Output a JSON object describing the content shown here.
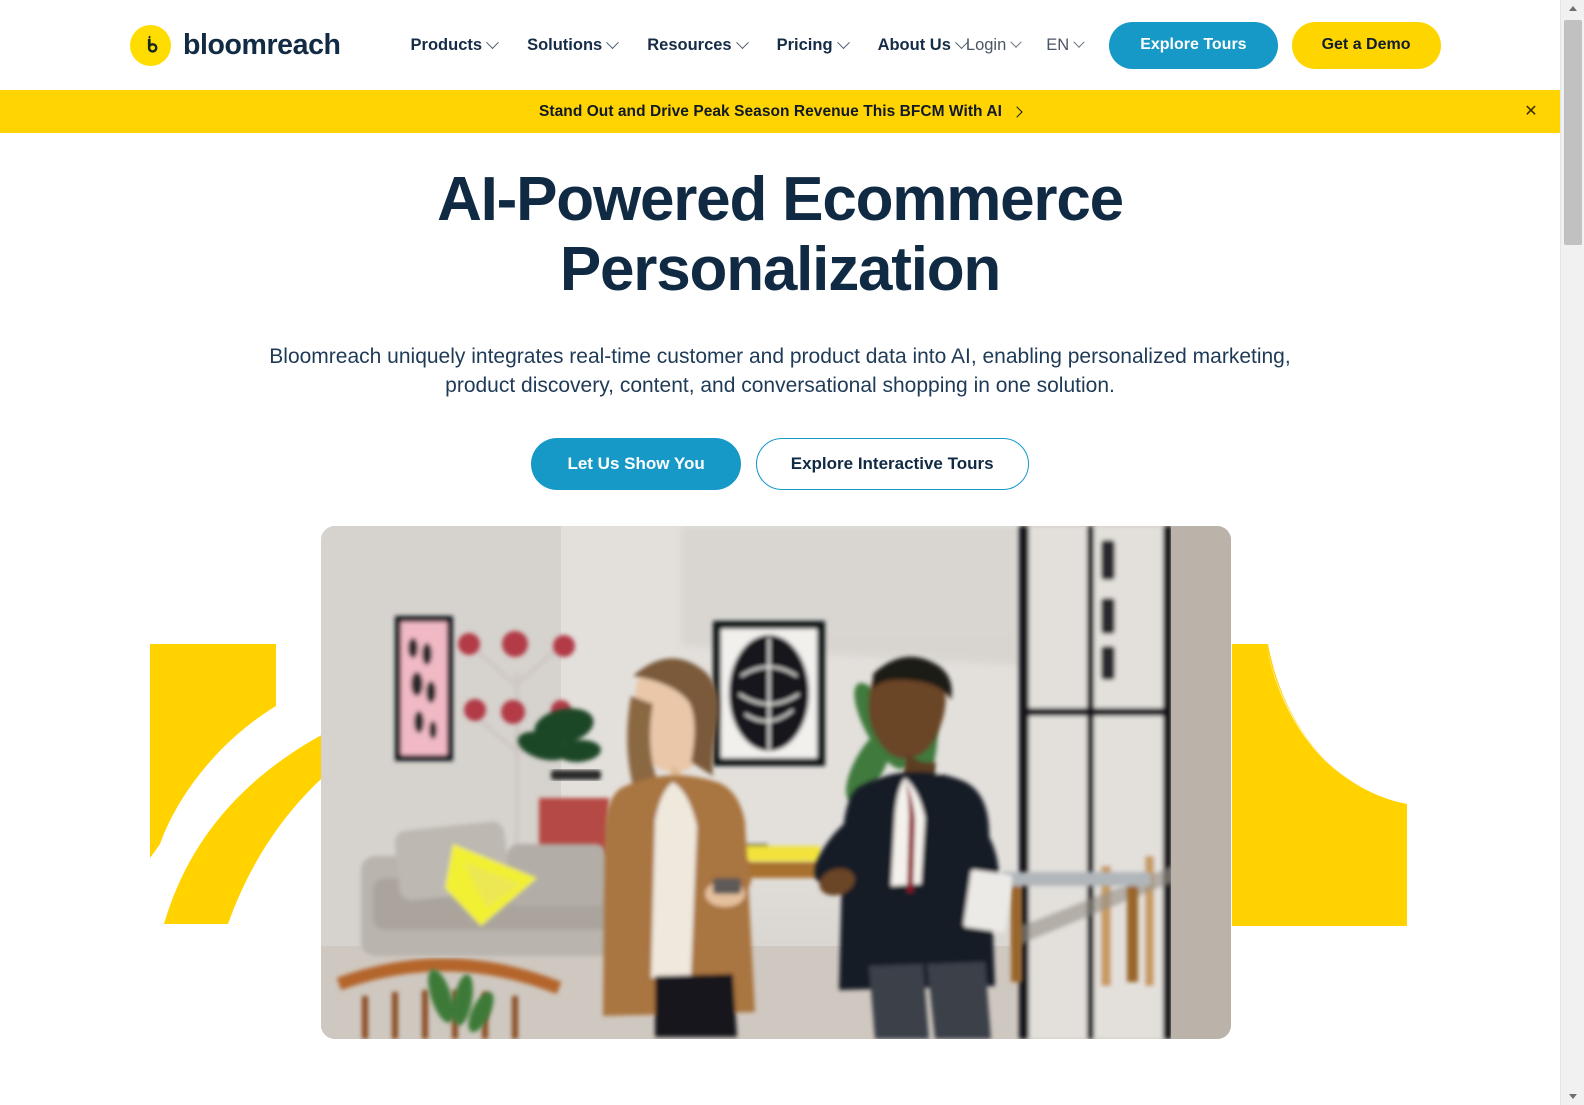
{
  "header": {
    "logo": {
      "mark_icon": "bloomreach-b-icon",
      "wordmark": "bloomreach"
    },
    "nav": [
      {
        "label": "Products",
        "icon": "chevron-down-icon"
      },
      {
        "label": "Solutions",
        "icon": "chevron-down-icon"
      },
      {
        "label": "Resources",
        "icon": "chevron-down-icon"
      },
      {
        "label": "Pricing",
        "icon": "chevron-down-icon"
      },
      {
        "label": "About Us",
        "icon": "chevron-down-icon"
      }
    ],
    "utils": [
      {
        "label": "Login",
        "icon": "chevron-down-icon"
      },
      {
        "label": "EN",
        "icon": "chevron-down-icon"
      }
    ],
    "explore_tours_label": "Explore Tours",
    "get_demo_label": "Get a Demo"
  },
  "banner": {
    "text": "Stand Out and Drive Peak Season Revenue This BFCM With AI",
    "arrow_icon": "chevron-right-icon",
    "close_icon": "close-icon",
    "close_glyph": "✕",
    "background_color": "#FFD400"
  },
  "hero": {
    "title_line_1": "AI-Powered Ecommerce",
    "title_line_2": "Personalization",
    "subtitle": "Bloomreach uniquely integrates real-time customer and product data into AI, enabling personalized marketing, product discovery, content, and conversational shopping in one solution.",
    "primary_cta": "Let Us Show You",
    "secondary_cta": "Explore Interactive Tours",
    "media_alt": "Two colleagues talking in a modern office lounge"
  },
  "decor": {
    "left_shape_icon": "yellow-swoosh-left-icon",
    "right_shape_icon": "yellow-swoosh-right-icon",
    "color": "#FFD200"
  },
  "colors": {
    "brand_yellow": "#FFD400",
    "brand_blue": "#1799C8",
    "navy_text": "#102A43"
  },
  "scrollbar": {
    "up_icon": "scroll-up-arrow-icon",
    "down_icon": "scroll-down-arrow-icon",
    "thumb_icon": "scrollbar-thumb"
  }
}
